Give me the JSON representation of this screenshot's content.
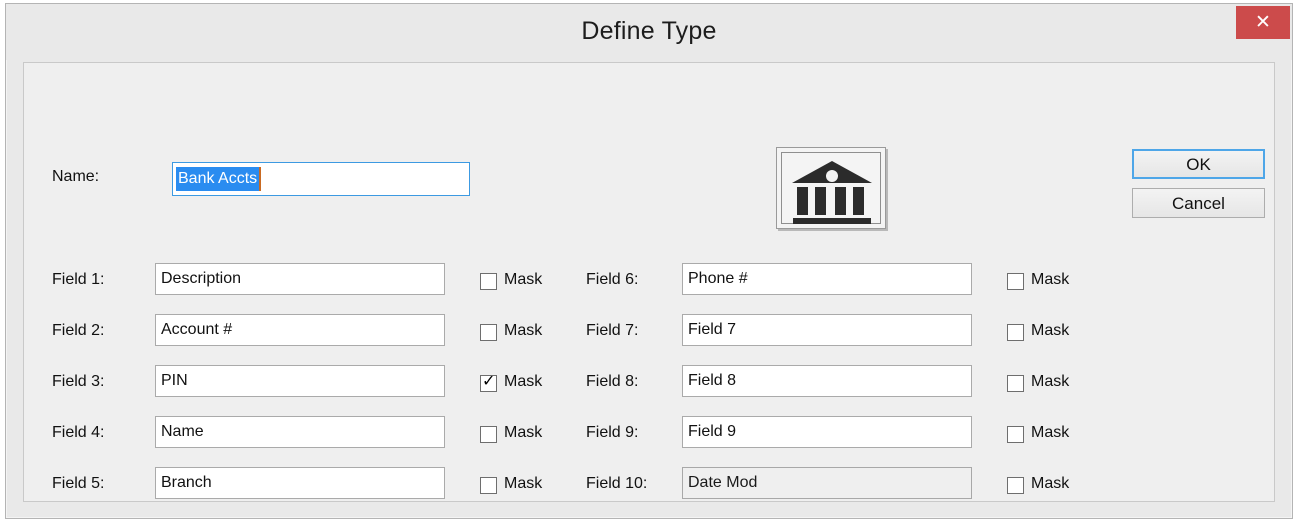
{
  "window": {
    "title": "Define Type",
    "close_label": "✕",
    "close_color": "#cc4b4b"
  },
  "name_row": {
    "label": "Name:",
    "value": "Bank Accts",
    "selected": true,
    "selection_color": "#2a8cf0",
    "focus_border_color": "#3c9ae2"
  },
  "icon": {
    "name": "bank-building-icon",
    "columns": 4
  },
  "buttons": {
    "ok": {
      "label": "OK",
      "focused": true
    },
    "cancel": {
      "label": "Cancel",
      "focused": false
    }
  },
  "mask_label": "Mask",
  "fields_left": [
    {
      "label": "Field 1:",
      "value": "Description",
      "mask": false,
      "disabled": false
    },
    {
      "label": "Field 2:",
      "value": "Account #",
      "mask": false,
      "disabled": false
    },
    {
      "label": "Field 3:",
      "value": "PIN",
      "mask": true,
      "disabled": false
    },
    {
      "label": "Field 4:",
      "value": "Name",
      "mask": false,
      "disabled": false
    },
    {
      "label": "Field 5:",
      "value": "Branch",
      "mask": false,
      "disabled": false
    }
  ],
  "fields_right": [
    {
      "label": "Field 6:",
      "value": "Phone #",
      "mask": false,
      "disabled": false
    },
    {
      "label": "Field 7:",
      "value": "Field 7",
      "mask": false,
      "disabled": false
    },
    {
      "label": "Field 8:",
      "value": "Field 8",
      "mask": false,
      "disabled": false
    },
    {
      "label": "Field 9:",
      "value": "Field 9",
      "mask": false,
      "disabled": false
    },
    {
      "label": "Field 10:",
      "value": "Date Mod",
      "mask": false,
      "disabled": true
    }
  ]
}
